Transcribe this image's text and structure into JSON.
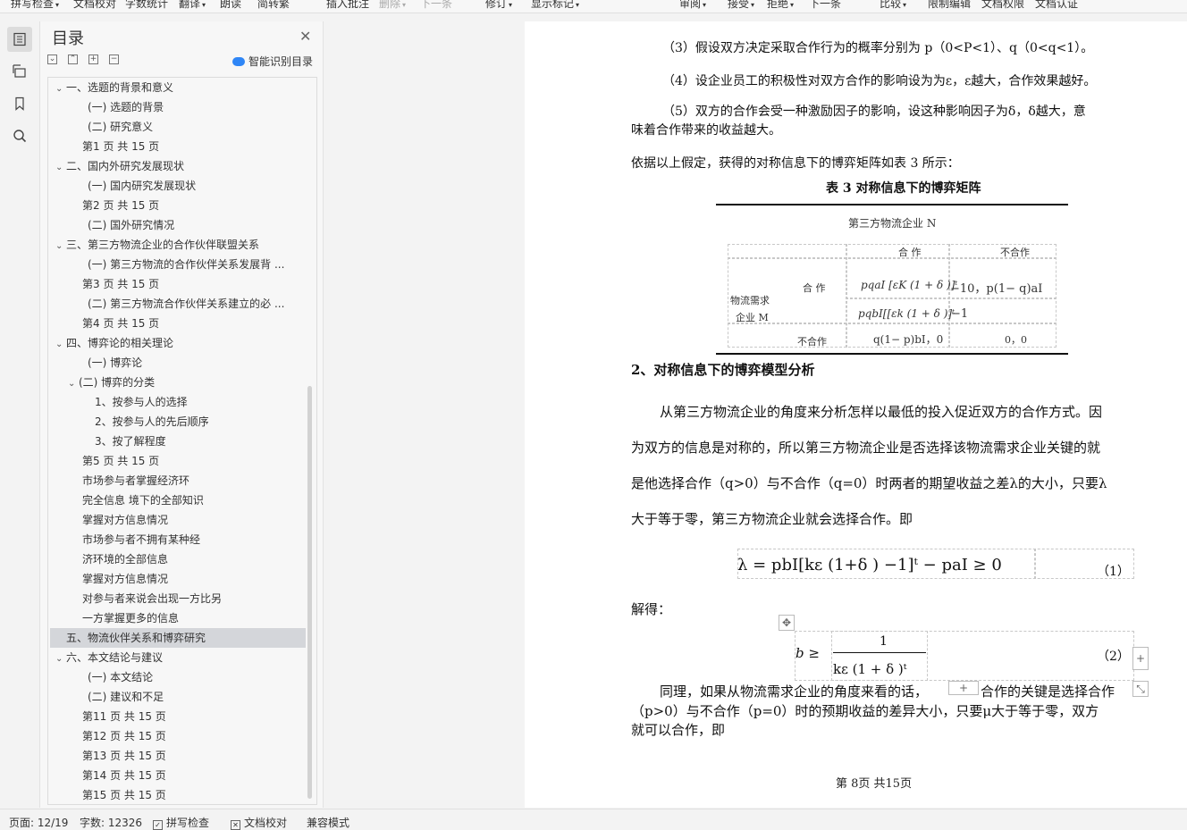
{
  "toolbar": {
    "items": [
      {
        "label": "拼写检查",
        "caret": true,
        "disabled": false
      },
      {
        "label": "文档校对",
        "caret": false,
        "disabled": false
      },
      {
        "label": "字数统计",
        "caret": false,
        "disabled": false
      },
      {
        "label": "翻译",
        "caret": true,
        "disabled": false
      },
      {
        "label": "朗读",
        "caret": false,
        "disabled": false
      },
      {
        "label": "简转繁",
        "caret": false,
        "disabled": false
      },
      {
        "label": "插入批注",
        "caret": false,
        "disabled": false
      },
      {
        "label": "删除",
        "caret": true,
        "disabled": true
      },
      {
        "label": "下一条",
        "caret": false,
        "disabled": true
      },
      {
        "label": "修订",
        "caret": true,
        "disabled": false
      },
      {
        "label": "显示标记",
        "caret": true,
        "disabled": false
      },
      {
        "label": "审阅",
        "caret": true,
        "disabled": false
      },
      {
        "label": "接受",
        "caret": true,
        "disabled": false
      },
      {
        "label": "拒绝",
        "caret": true,
        "disabled": false
      },
      {
        "label": "下一条",
        "caret": false,
        "disabled": false
      },
      {
        "label": "比较",
        "caret": true,
        "disabled": false
      },
      {
        "label": "限制编辑",
        "caret": false,
        "disabled": false
      },
      {
        "label": "文档权限",
        "caret": false,
        "disabled": false
      },
      {
        "label": "文档认证",
        "caret": false,
        "disabled": false
      }
    ]
  },
  "toc": {
    "title": "目录",
    "smart_label": "智能识别目录",
    "items": [
      {
        "label": "一、选题的背景和意义",
        "level": 1,
        "chevron": "down"
      },
      {
        "label": "(一)  选题的背景",
        "level": 2
      },
      {
        "label": "(二)  研究意义",
        "level": 2
      },
      {
        "label": "第1 页 共 15 页",
        "level": 2,
        "plain": true
      },
      {
        "label": "二、国内外研究发展现状",
        "level": 1,
        "chevron": "down"
      },
      {
        "label": "(一)  国内研究发展现状",
        "level": 2
      },
      {
        "label": "第2 页 共 15 页",
        "level": 2,
        "plain": true
      },
      {
        "label": "(二)  国外研究情况",
        "level": 2
      },
      {
        "label": "三、第三方物流企业的合作伙伴联盟关系",
        "level": 1,
        "chevron": "down"
      },
      {
        "label": "(一)  第三方物流的合作伙伴关系发展背 ...",
        "level": 2
      },
      {
        "label": "第3 页 共 15 页",
        "level": 2,
        "plain": true
      },
      {
        "label": "(二)  第三方物流合作伙伴关系建立的必 ...",
        "level": 2
      },
      {
        "label": "第4 页 共 15 页",
        "level": 2,
        "plain": true
      },
      {
        "label": "四、博弈论的相关理论",
        "level": 1,
        "chevron": "down"
      },
      {
        "label": "(一)  博弈论",
        "level": 2
      },
      {
        "label": "(二)  博弈的分类",
        "level": 2,
        "chevron": "down"
      },
      {
        "label": "1、按参与人的选择",
        "level": 3
      },
      {
        "label": "2、按参与人的先后顺序",
        "level": 3
      },
      {
        "label": "3、按了解程度",
        "level": 3
      },
      {
        "label": "第5 页 共 15 页",
        "level": 2,
        "plain": true
      },
      {
        "label": "市场参与者掌握经济环",
        "level": 2,
        "plain": true
      },
      {
        "label": "完全信息 境下的全部知识",
        "level": 2,
        "plain": true
      },
      {
        "label": "掌握对方信息情况",
        "level": 2,
        "plain": true
      },
      {
        "label": "市场参与者不拥有某种经",
        "level": 2,
        "plain": true
      },
      {
        "label": "济环境的全部信息",
        "level": 2,
        "plain": true
      },
      {
        "label": "掌握对方信息情况",
        "level": 2,
        "plain": true
      },
      {
        "label": "对参与者来说会出现一方比另",
        "level": 2,
        "plain": true
      },
      {
        "label": "一方掌握更多的信息",
        "level": 2,
        "plain": true
      },
      {
        "label": "五、物流伙伴关系和博弈研究",
        "level": 1,
        "selected": true
      },
      {
        "label": "六、本文结论与建议",
        "level": 1,
        "chevron": "down"
      },
      {
        "label": "(一)  本文结论",
        "level": 2
      },
      {
        "label": "(二)  建议和不足",
        "level": 2
      },
      {
        "label": "第11 页 共 15 页",
        "level": 2,
        "plain": true
      },
      {
        "label": "第12 页 共 15 页",
        "level": 2,
        "plain": true
      },
      {
        "label": "第13 页 共 15 页",
        "level": 2,
        "plain": true
      },
      {
        "label": "第14 页 共 15 页",
        "level": 2,
        "plain": true
      },
      {
        "label": "第15 页 共 15 页",
        "level": 2,
        "plain": true
      }
    ]
  },
  "doc": {
    "para3": "（3）假设双方决定采取合作行为的概率分别为 p（0<P<1）、q（0<q<1）。",
    "para4": "（4）设企业员工的积极性对双方合作的影响设为为ε，ε越大，合作效果越好。",
    "para5a": "（5）双方的合作会受一种激励因子的影响，设这种影响因子为δ，δ越大，意",
    "para5b": "味着合作带来的收益越大。",
    "intro": "依据以上假定，获得的对称信息下的博弈矩阵如表 3 所示：",
    "table_title": "表 3 对称信息下的博弈矩阵",
    "table": {
      "top_label": "第三方物流企业 N",
      "col_coop": "合 作",
      "col_noncoop": "不合作",
      "row_coop": "合 作",
      "row_party_a": "物流需求",
      "row_party_b": "企业 M",
      "row_noncoop": "不合作",
      "cell_cc": "pqaI [εK (1 + δ )]ᵗ",
      "cell_cn": "−10，p(1− q)aI",
      "cell_cc2": "pqbI[[εk (1 + δ )]ᵗ",
      "cell_cc2b": "−1",
      "cell_nc": "q(1− p)bI，0",
      "cell_nn": "0，0"
    },
    "heading2": "2、对称信息下的博弈模型分析",
    "p1": "从第三方物流企业的角度来分析怎样以最低的投入促近双方的合作方式。因",
    "p2": "为双方的信息是对称的，所以第三方物流企业是否选择该物流需求企业关键的就",
    "p3": "是他选择合作（q>0）与不合作（q=0）时两者的期望收益之差λ的大小，只要λ",
    "p4": "大于等于零，第三方物流企业就会选择合作。即",
    "eq1": "λ = pbI[kε (1+δ ) −1]ᵗ − paI ≥ 0",
    "eq1_num": "（1）",
    "solve": "解得：",
    "eq2_lhs": "b ≥",
    "eq2_num_top": "1",
    "eq2_den": "kε (1    + δ )ᵗ",
    "eq2_num": "（2）",
    "q1a": "同理，如果从物流需求企业的角度来看的话，",
    "q1b": "合作的关键是选择合作",
    "q2": "（p>0）与不合作（p=0）时的预期收益的差异大小，只要μ大于等于零，双方",
    "q3": "就可以合作，即",
    "footer": "第 8页 共15页"
  },
  "status": {
    "page": "页面: 12/19",
    "words": "字数: 12326",
    "spell": "拼写检查",
    "proof": "文档校对",
    "compat": "兼容模式"
  },
  "icons": {
    "toc_rail": "outline-icon",
    "selection_rail": "selection-icon",
    "bookmark_rail": "bookmark-icon",
    "search_rail": "search-icon"
  },
  "colors": {
    "accent": "#2f86f6",
    "selected_row": "#d4d6da"
  }
}
